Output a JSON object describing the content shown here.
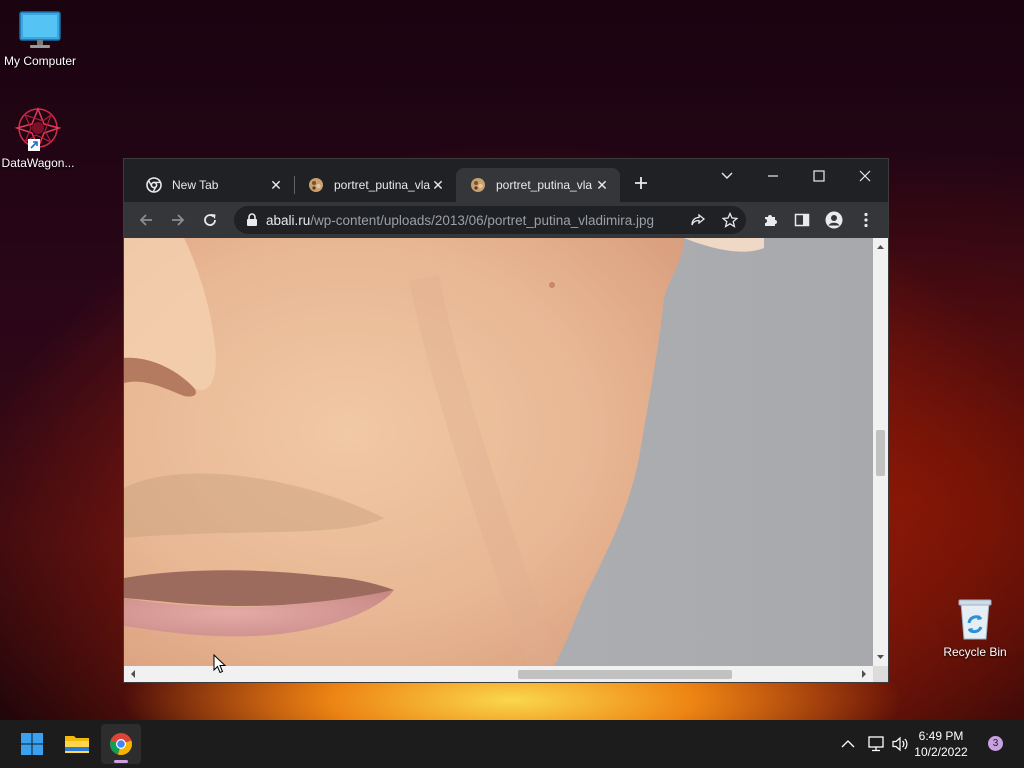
{
  "desktop": {
    "icons": [
      {
        "label": "My Computer",
        "icon": "monitor-icon"
      },
      {
        "label": "DataWagon...",
        "icon": "datawagon-icon"
      },
      {
        "label": "Recycle Bin",
        "icon": "recycle-bin-icon"
      }
    ]
  },
  "browser": {
    "tabs": [
      {
        "title": "New Tab",
        "icon": "chrome-icon",
        "active": false
      },
      {
        "title": "portret_putina_vla",
        "icon": "image-favicon-icon",
        "active": false
      },
      {
        "title": "portret_putina_vla",
        "icon": "image-favicon-icon",
        "active": true
      }
    ],
    "url": {
      "host": "abali.ru",
      "path": "/wp-content/uploads/2013/06/portret_putina_vladimira.jpg"
    },
    "colors": {
      "frame": "#202124",
      "toolbar": "#35363a",
      "text": "#e8eaed"
    }
  },
  "taskbar": {
    "items": [
      "start-icon",
      "file-explorer-icon",
      "chrome-icon"
    ],
    "tray": [
      "chevron-up-icon",
      "network-icon",
      "volume-icon"
    ],
    "time": "6:49 PM",
    "date": "10/2/2022",
    "notifications": "3"
  }
}
